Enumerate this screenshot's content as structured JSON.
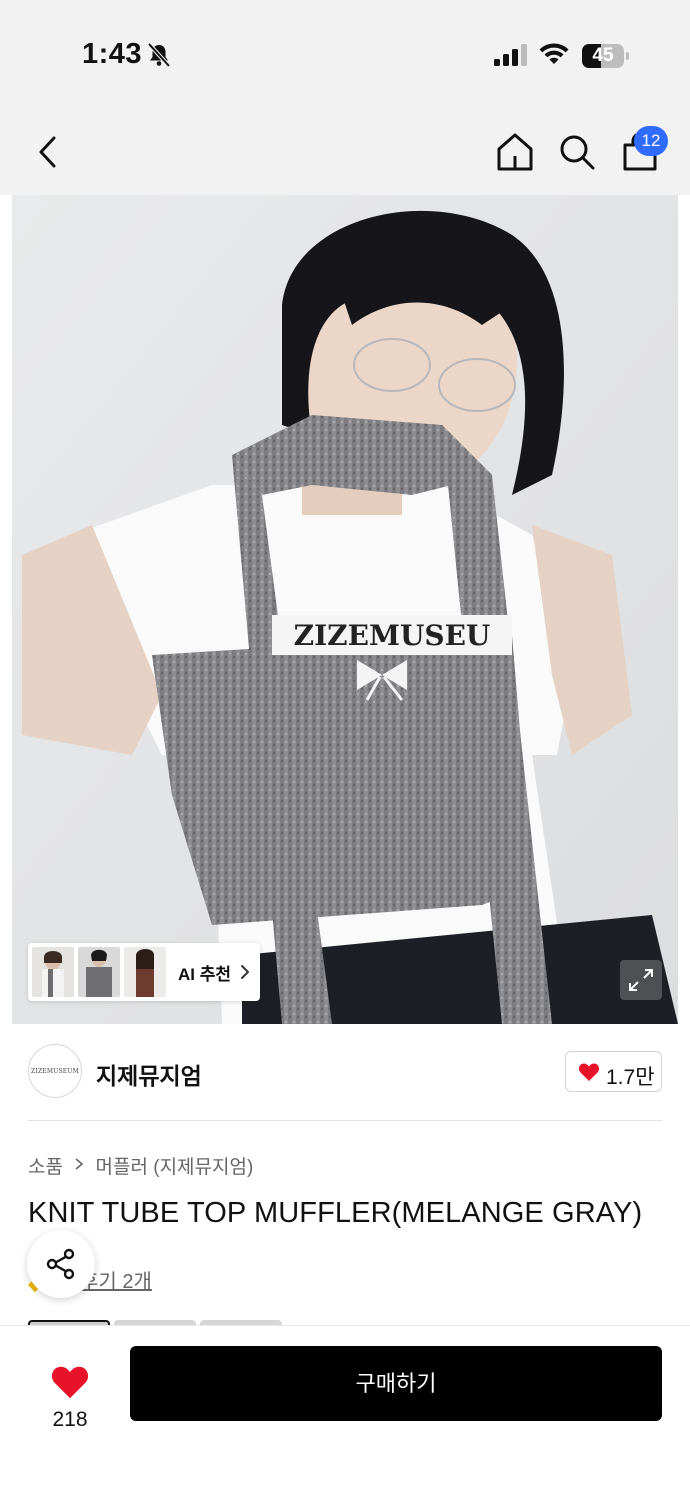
{
  "status_bar": {
    "time": "1:43",
    "battery_level": "45"
  },
  "nav": {
    "cart_count": "12",
    "icons": [
      "back-arrow-icon",
      "home-icon",
      "search-icon",
      "shopping-bag-icon"
    ]
  },
  "gallery": {
    "ai_recommend_label": "AI 추천",
    "expand_icon": "expand-icon"
  },
  "brand": {
    "logo_text": "ZIZEMUSEUM",
    "name": "지제뮤지엄",
    "like_count": "1.7만"
  },
  "product": {
    "breadcrumb_category": "소품",
    "breadcrumb_subcategory": "머플러 (지제뮤지엄)",
    "title": "KNIT TUBE TOP MUFFLER(MELANGE GRAY)",
    "reviews_text": "후기 2개"
  },
  "bottom": {
    "wish_count": "218",
    "buy_label": "구매하기"
  },
  "colors": {
    "badge_blue": "#2f6bff",
    "heart_red": "#e8132b",
    "buy_black": "#000000"
  }
}
